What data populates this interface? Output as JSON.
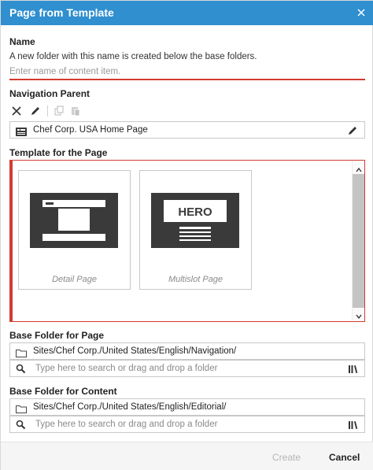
{
  "dialog": {
    "title": "Page from Template"
  },
  "name_section": {
    "label": "Name",
    "hint": "A new folder with this name is created below the base folders.",
    "placeholder": "Enter name of content item.",
    "value": ""
  },
  "navigation_parent": {
    "label": "Navigation Parent",
    "toolbar": [
      "close-icon",
      "pencil-icon",
      "copy-icon",
      "paste-icon"
    ],
    "value": "Chef Corp. USA Home Page"
  },
  "template_section": {
    "label": "Template for the Page",
    "templates": [
      {
        "label": "Detail Page",
        "icon": "detail-page-thumbnail"
      },
      {
        "label": "Multislot Page",
        "icon": "hero-page-thumbnail",
        "hero_text": "HERO"
      }
    ]
  },
  "base_folder_page": {
    "label": "Base Folder for Page",
    "path": "Sites/Chef Corp./United States/English/Navigation/",
    "search_placeholder": "Type here to search or drag and drop a folder"
  },
  "base_folder_content": {
    "label": "Base Folder for Content",
    "path": "Sites/Chef Corp./United States/English/Editorial/",
    "search_placeholder": "Type here to search or drag and drop a folder"
  },
  "footer": {
    "create_label": "Create",
    "cancel_label": "Cancel"
  },
  "colors": {
    "header": "#2f8fcf",
    "error": "#d33b32",
    "thumb": "#3a3a3a"
  }
}
